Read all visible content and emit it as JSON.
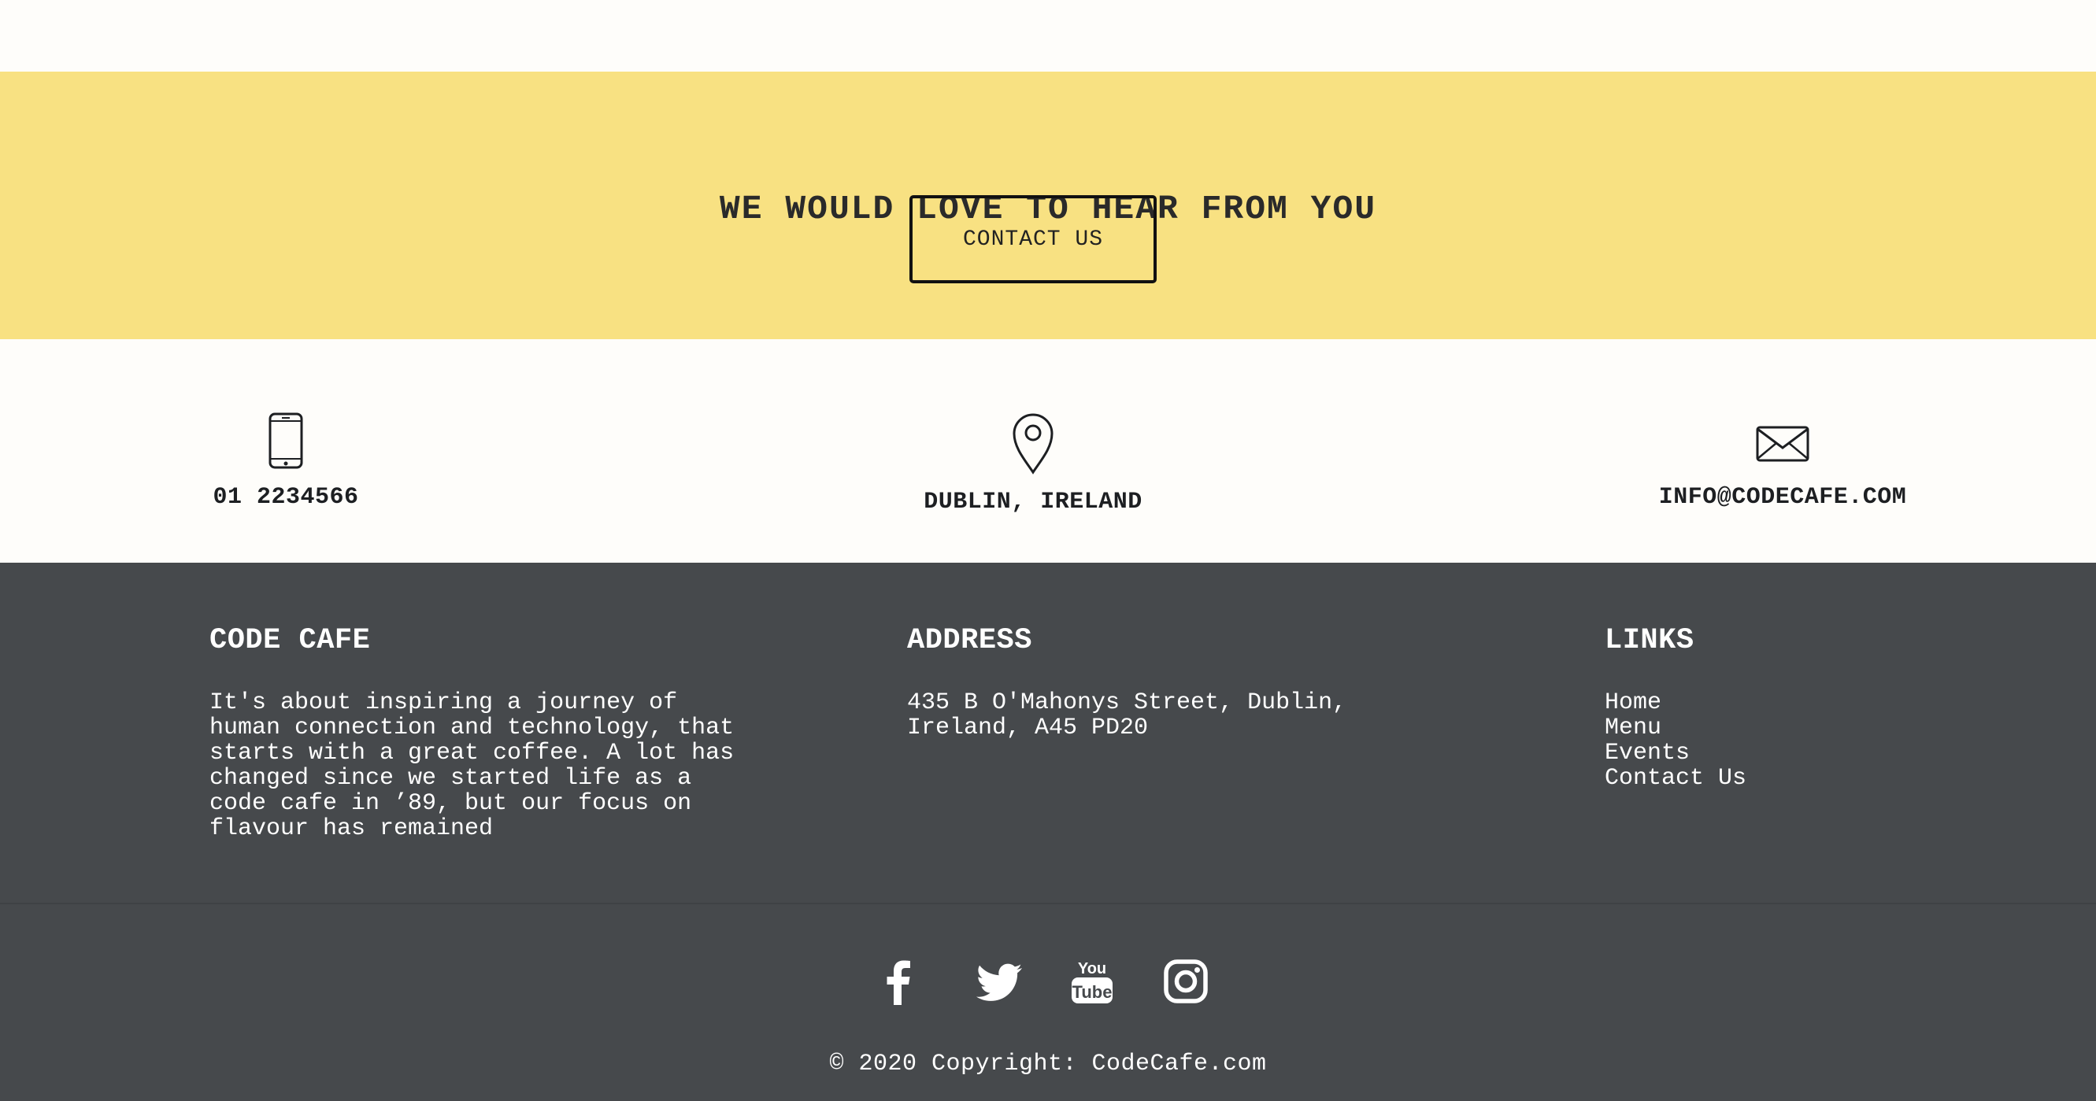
{
  "cta": {
    "title": "WE WOULD LOVE TO HEAR FROM YOU",
    "button_label": "CONTACT US",
    "background": "#f8e182"
  },
  "contact": {
    "phone": {
      "icon": "phone-icon",
      "label": "01 2234566"
    },
    "location": {
      "icon": "location-pin-icon",
      "label": "DUBLIN, IRELAND"
    },
    "email": {
      "icon": "envelope-icon",
      "label": "INFO@CODECAFE.COM"
    }
  },
  "footer": {
    "background": "#46494c",
    "about": {
      "heading": "CODE CAFE",
      "text": "It's about inspiring a journey of human connection and technology, that starts with a great coffee. A lot has changed since we started life as a code cafe in ’89, but our focus on flavour has remained"
    },
    "address": {
      "heading": "ADDRESS",
      "text": "435 B O'Mahonys Street, Dublin, Ireland, A45 PD20"
    },
    "links": {
      "heading": "LINKS",
      "items": [
        {
          "label": "Home"
        },
        {
          "label": "Menu"
        },
        {
          "label": "Events"
        },
        {
          "label": "Contact Us"
        }
      ]
    },
    "social": [
      {
        "icon": "facebook-icon"
      },
      {
        "icon": "twitter-icon"
      },
      {
        "icon": "youtube-icon"
      },
      {
        "icon": "instagram-icon"
      }
    ],
    "copyright": "© 2020 Copyright: CodeCafe.com"
  }
}
